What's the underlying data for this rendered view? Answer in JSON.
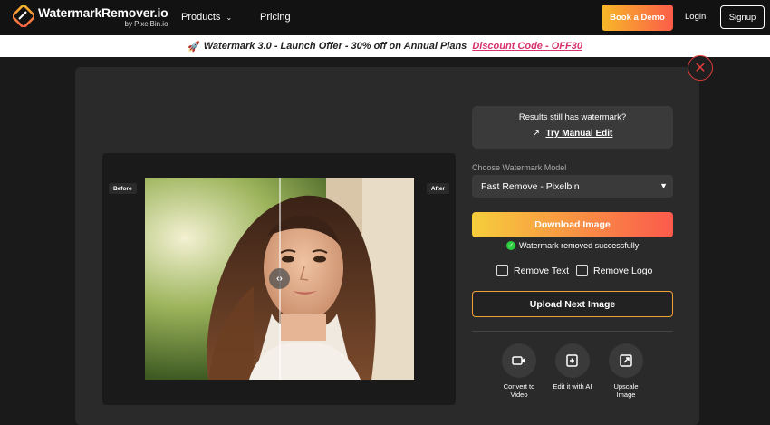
{
  "nav": {
    "logo_title": "WatermarkRemover.io",
    "logo_sub": "by PixelBin.io",
    "products": "Products",
    "pricing": "Pricing",
    "book_demo": "Book a Demo",
    "login": "Login",
    "signup": "Signup"
  },
  "banner": {
    "text": "Watermark 3.0 - Launch Offer - 30% off on Annual Plans",
    "code": "Discount Code - OFF30"
  },
  "viewer": {
    "before": "Before",
    "after": "After"
  },
  "manual": {
    "question": "Results still has watermark?",
    "link": "Try Manual Edit"
  },
  "model": {
    "label": "Choose Watermark Model",
    "selected": "Fast Remove - Pixelbin"
  },
  "actions": {
    "download": "Download Image",
    "success": "Watermark removed successfully",
    "remove_text": "Remove Text",
    "remove_logo": "Remove Logo",
    "upload_next": "Upload Next Image"
  },
  "tools": [
    {
      "label": "Convert to Video",
      "icon": "video-icon"
    },
    {
      "label": "Edit it with AI",
      "icon": "ai-edit-icon"
    },
    {
      "label": "Upscale Image",
      "icon": "upscale-icon"
    }
  ],
  "colors": {
    "accent_start": "#f7b928",
    "accent_end": "#fb5c48",
    "close": "#e23b3b",
    "discount": "#d6336c",
    "success": "#2ecc40"
  }
}
